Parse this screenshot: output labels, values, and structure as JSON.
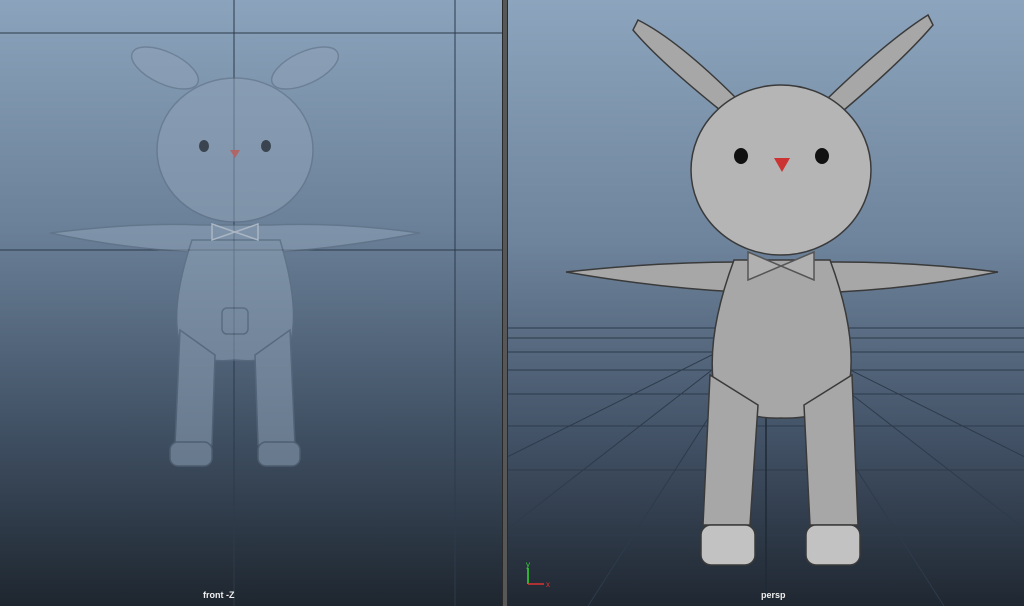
{
  "viewports": {
    "front": {
      "label": "front -Z"
    },
    "persp": {
      "label": "persp"
    }
  },
  "axis_gizmo": {
    "y_label": "y",
    "x_label": "x",
    "y_color": "#33dd33",
    "x_color": "#dd3333"
  },
  "model": {
    "name_icon": "bunny-model",
    "body_color": "#9a9a9a",
    "nose_color": "#cc3333",
    "eye_color": "#111111"
  }
}
